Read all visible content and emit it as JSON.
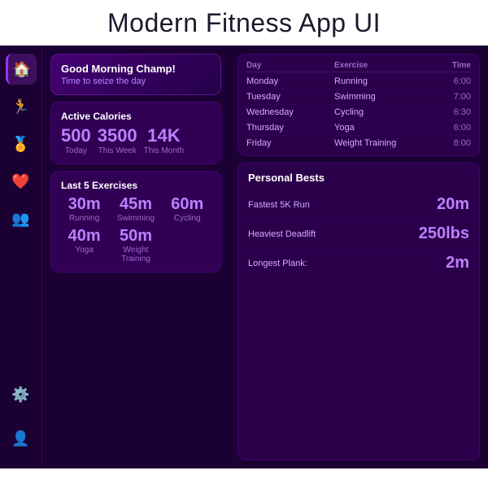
{
  "app": {
    "title": "Modern Fitness App UI"
  },
  "sidebar": {
    "items": [
      {
        "id": "home",
        "icon": "🏠",
        "active": true
      },
      {
        "id": "activity",
        "icon": "🏃",
        "active": false
      },
      {
        "id": "trophy",
        "icon": "🏅",
        "active": false
      },
      {
        "id": "heart",
        "icon": "❤️",
        "active": false
      },
      {
        "id": "community",
        "icon": "👥",
        "active": false
      }
    ],
    "bottom_items": [
      {
        "id": "settings",
        "icon": "⚙️"
      },
      {
        "id": "profile",
        "icon": "👤"
      }
    ]
  },
  "greeting": {
    "title": "Good Morning Champ!",
    "subtitle": "Time to seize the day"
  },
  "active_calories": {
    "label": "Active Calories",
    "today_value": "500",
    "today_label": "Today",
    "week_value": "3500",
    "week_label": "This Week",
    "month_value": "14K",
    "month_label": "This Month"
  },
  "last_exercises": {
    "label": "Last 5 Exercises",
    "items": [
      {
        "time": "30m",
        "name": "Running"
      },
      {
        "time": "45m",
        "name": "Swimming"
      },
      {
        "time": "60m",
        "name": "Cycling"
      },
      {
        "time": "40m",
        "name": "Yoga"
      },
      {
        "time": "50m",
        "name": "Weight\nTraining"
      }
    ]
  },
  "schedule": {
    "headers": [
      "Day",
      "Exercise",
      "Time"
    ],
    "rows": [
      {
        "day": "Monday",
        "exercise": "Running",
        "time": "6:00"
      },
      {
        "day": "Tuesday",
        "exercise": "Swimming",
        "time": "7:00"
      },
      {
        "day": "Wednesday",
        "exercise": "Cycling",
        "time": "6:30"
      },
      {
        "day": "Thursday",
        "exercise": "Yoga",
        "time": "6:00"
      },
      {
        "day": "Friday",
        "exercise": "Weight Training",
        "time": "8:00"
      }
    ]
  },
  "personal_bests": {
    "label": "Personal Bests",
    "items": [
      {
        "label": "Fastest 5K Run",
        "value": "20m"
      },
      {
        "label": "Heaviest Deadlift",
        "value": "250lbs"
      },
      {
        "label": "Longest Plank:",
        "value": "2m"
      }
    ]
  }
}
